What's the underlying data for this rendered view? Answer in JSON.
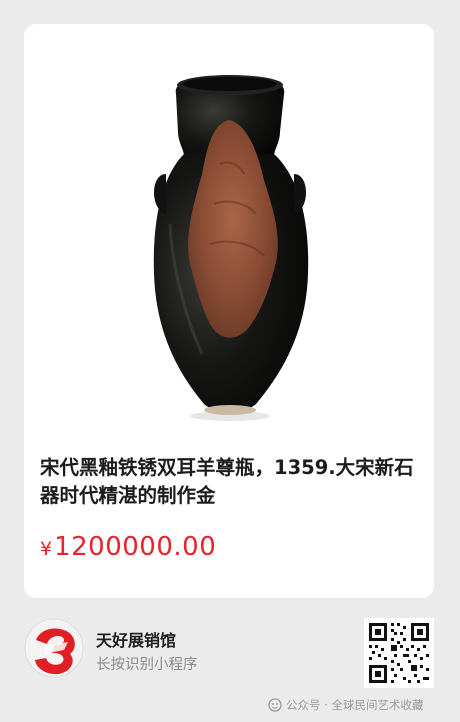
{
  "product": {
    "title": "宋代黑釉铁锈双耳羊尊瓶，1359.大宋新石器时代精湛的制作金",
    "currency_symbol": "¥",
    "price": "1200000.00",
    "image_icon": "vase-image"
  },
  "shop": {
    "name": "天好展销馆",
    "subtitle": "长按识别小程序",
    "logo_icon": "shop-logo-3",
    "qr_icon": "mini-program-qr-code"
  },
  "watermark": {
    "text": "公众号 · 全球民间艺术收藏",
    "icon": "wechat-official-account-icon"
  },
  "colors": {
    "price": "#e8232b",
    "logo_red": "#e01f25",
    "background": "#ebebeb",
    "card": "#ffffff"
  }
}
